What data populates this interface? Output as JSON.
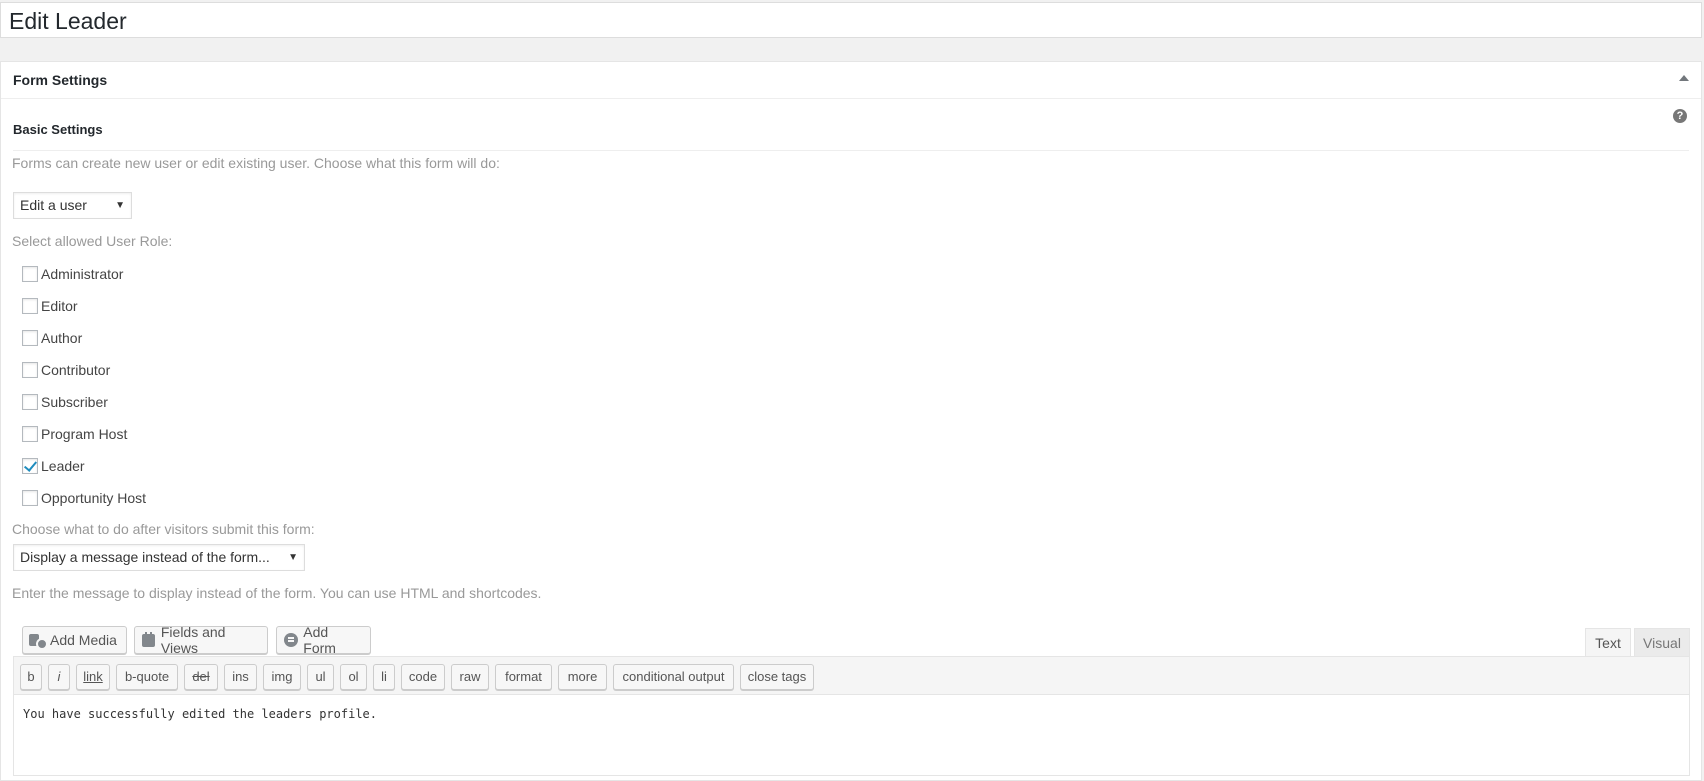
{
  "page": {
    "title": "Edit Leader"
  },
  "form_settings": {
    "panel_title": "Form Settings",
    "section_title": "Basic Settings",
    "help_glyph": "?",
    "action_label": "Forms can create new user or edit existing user. Choose what this form will do:",
    "action_value": "Edit a user",
    "roles_label": "Select allowed User Role:",
    "roles": [
      {
        "label": "Administrator",
        "checked": false
      },
      {
        "label": "Editor",
        "checked": false
      },
      {
        "label": "Author",
        "checked": false
      },
      {
        "label": "Contributor",
        "checked": false
      },
      {
        "label": "Subscriber",
        "checked": false
      },
      {
        "label": "Program Host",
        "checked": false
      },
      {
        "label": "Leader",
        "checked": true
      },
      {
        "label": "Opportunity Host",
        "checked": false
      }
    ],
    "after_submit_label": "Choose what to do after visitors submit this form:",
    "after_submit_value": "Display a message instead of the form...",
    "message_label": "Enter the message to display instead of the form. You can use HTML and shortcodes."
  },
  "editor": {
    "media_buttons": [
      "Add Media",
      "Fields and Views",
      "Add Form"
    ],
    "tabs": {
      "text": "Text",
      "visual": "Visual"
    },
    "quicktags": [
      "b",
      "i",
      "link",
      "b-quote",
      "del",
      "ins",
      "img",
      "ul",
      "ol",
      "li",
      "code",
      "raw",
      "format",
      "more",
      "conditional output",
      "close tags"
    ],
    "content": "You have successfully edited the leaders profile."
  }
}
